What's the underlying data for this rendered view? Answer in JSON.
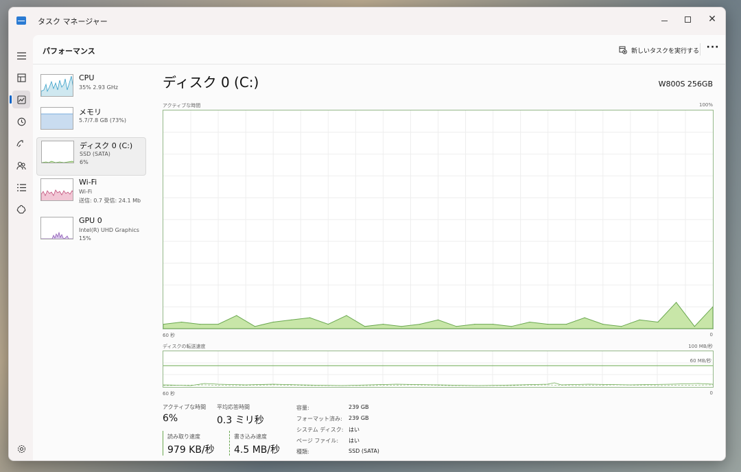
{
  "window": {
    "title": "タスク マネージャー"
  },
  "header": {
    "title": "パフォーマンス",
    "run_new_task": "新しいタスクを実行する",
    "more": "···"
  },
  "nav_icons": [
    "menu-icon",
    "processes-icon",
    "performance-icon",
    "app-history-icon",
    "startup-apps-icon",
    "users-icon",
    "details-icon",
    "services-icon",
    "settings-icon"
  ],
  "sidebar": {
    "items": [
      {
        "name": "CPU",
        "sub1": "35%  2.93 GHz",
        "sub2": ""
      },
      {
        "name": "メモリ",
        "sub1": "5.7/7.8 GB (73%)",
        "sub2": ""
      },
      {
        "name": "ディスク 0 (C:)",
        "sub1": "SSD (SATA)",
        "sub2": "6%"
      },
      {
        "name": "Wi-Fi",
        "sub1": "Wi-Fi",
        "sub2": "送信: 0.7  受信: 24.1 Mb"
      },
      {
        "name": "GPU 0",
        "sub1": "Intel(R) UHD Graphics",
        "sub2": "15%"
      }
    ]
  },
  "main": {
    "title": "ディスク 0 (C:)",
    "model": "W800S 256GB",
    "active_time_graph": {
      "label": "アクティブな時間",
      "max": "100%",
      "left": "60 秒",
      "right": "0"
    },
    "transfer_graph": {
      "label": "ディスクの転送速度",
      "max": "100 MB/秒",
      "mid": "60 MB/秒",
      "left": "60 秒",
      "right": "0"
    },
    "stats": {
      "active_time_label": "アクティブな時間",
      "active_time": "6%",
      "avg_response_label": "平均応答時間",
      "avg_response": "0.3 ミリ秒",
      "read_label": "読み取り速度",
      "read": "979 KB/秒",
      "write_label": "書き込み速度",
      "write": "4.5 MB/秒"
    },
    "properties": [
      {
        "label": "容量:",
        "value": "239 GB"
      },
      {
        "label": "フォーマット済み:",
        "value": "239 GB"
      },
      {
        "label": "システム ディスク:",
        "value": "はい"
      },
      {
        "label": "ページ ファイル:",
        "value": "はい"
      },
      {
        "label": "種類:",
        "value": "SSD (SATA)"
      }
    ]
  },
  "colors": {
    "accent": "#0a64c8",
    "disk_line": "#6aa84f",
    "disk_fill": "#c8e6a8",
    "cpu": "#3aa0c8",
    "memory": "#5b9bd5",
    "wifi": "#c0507a",
    "gpu": "#8e5bb5"
  },
  "chart_data": {
    "type": "area",
    "title": "アクティブな時間",
    "xlabel": "",
    "ylabel": "",
    "x": [
      60,
      58,
      56,
      54,
      52,
      50,
      48,
      46,
      44,
      42,
      40,
      38,
      36,
      34,
      32,
      30,
      28,
      26,
      24,
      22,
      20,
      18,
      16,
      14,
      12,
      10,
      8,
      6,
      4,
      2,
      0
    ],
    "xlim": [
      60,
      0
    ],
    "ylim": [
      0,
      100
    ],
    "series": [
      {
        "values": [
          2,
          3,
          2,
          2,
          6,
          1,
          3,
          4,
          5,
          2,
          6,
          1,
          2,
          1,
          2,
          4,
          1,
          2,
          2,
          1,
          3,
          2,
          2,
          5,
          2,
          1,
          4,
          3,
          12,
          1,
          10
        ]
      }
    ]
  }
}
